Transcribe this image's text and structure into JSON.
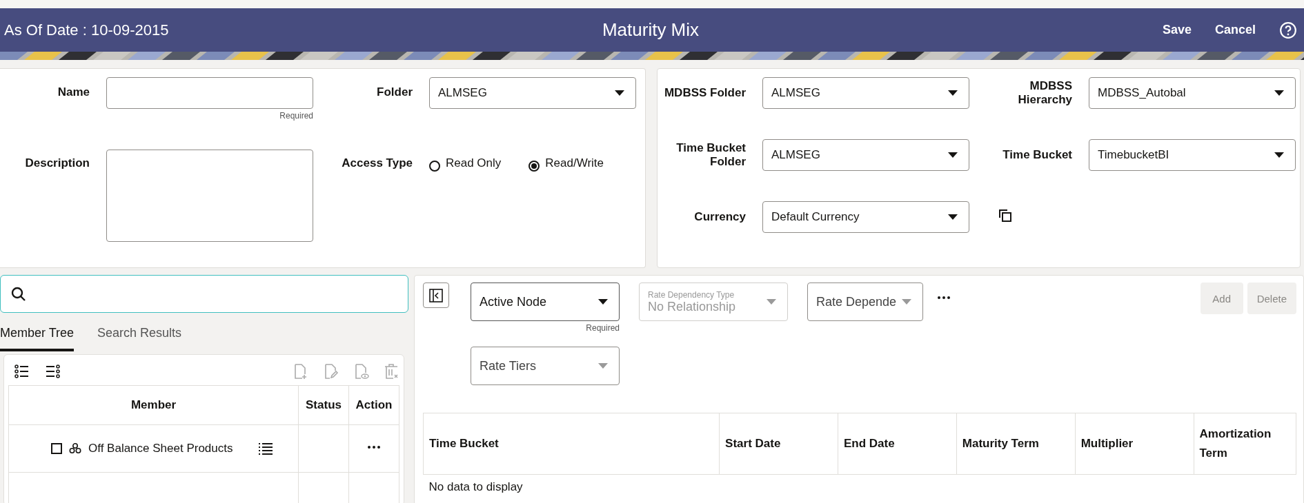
{
  "header": {
    "as_of_date": "As Of Date : 10-09-2015",
    "title": "Maturity Mix",
    "buttons": [
      "Save",
      "Cancel"
    ]
  },
  "definition": {
    "name": {
      "label": "Name",
      "hint": "Required"
    },
    "description": {
      "label": "Description"
    },
    "folder": {
      "label": "Folder",
      "value": "ALMSEG"
    },
    "access_type": {
      "label": "Access Type",
      "options": [
        {
          "label": "Read Only",
          "selected": false
        },
        {
          "label": "Read/Write",
          "selected": true
        }
      ]
    }
  },
  "settings": [
    {
      "label": "MDBSS Folder",
      "value": "ALMSEG"
    },
    {
      "label": "MDBSS Hierarchy",
      "value": "MDBSS_Autobal"
    },
    {
      "label": "Time Bucket Folder",
      "value": "ALMSEG"
    },
    {
      "label": "Time Bucket",
      "value": "TimebucketBI"
    },
    {
      "label": "Currency",
      "value": "Default Currency"
    }
  ],
  "tabs": [
    {
      "label": "Member Tree",
      "selected": true
    },
    {
      "label": "Search Results",
      "selected": false
    }
  ],
  "tree": {
    "columns": [
      "Member",
      "Status",
      "Action"
    ],
    "rows": [
      {
        "label": "Off Balance Sheet Products",
        "checked": false
      }
    ]
  },
  "filters": [
    {
      "kind": "select",
      "label": "Active Node",
      "hint": "Required"
    },
    {
      "kind": "floating",
      "label": "Rate Dependency Type",
      "value": "No Relationship",
      "disabled": true
    },
    {
      "kind": "select",
      "label": "Rate Depende"
    },
    {
      "kind": "select",
      "label": "Rate Tiers"
    }
  ],
  "actions": [
    {
      "label": "Add",
      "disabled": true
    },
    {
      "label": "Delete",
      "disabled": true
    }
  ],
  "table": {
    "columns": [
      "Time Bucket",
      "Start Date",
      "End Date",
      "Maturity Term",
      "Multiplier",
      "Amortization Term"
    ],
    "empty_message": "No data to display"
  }
}
